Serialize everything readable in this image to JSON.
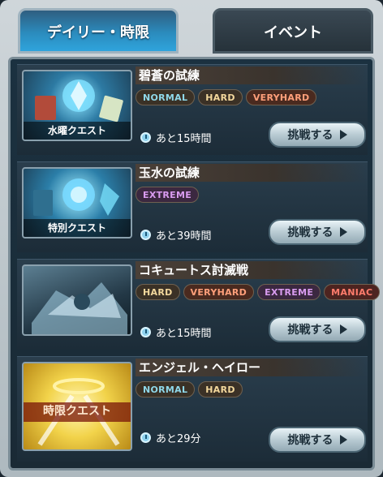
{
  "tabs": {
    "active_label": "デイリー・時限",
    "inactive_label": "イベント"
  },
  "quests": [
    {
      "banner_label": "水曜クエスト",
      "title": "碧蒼の試練",
      "difficulties": [
        "NORMAL",
        "HARD",
        "VERYHARD"
      ],
      "time": "あと15時間",
      "button": "挑戦する"
    },
    {
      "banner_label": "特別クエスト",
      "title": "玉水の試練",
      "difficulties": [
        "EXTREME"
      ],
      "time": "あと39時間",
      "button": "挑戦する"
    },
    {
      "banner_label": "",
      "title": "コキュートス討滅戦",
      "difficulties": [
        "HARD",
        "VERYHARD",
        "EXTREME",
        "MANIAC"
      ],
      "time": "あと15時間",
      "button": "挑戦する"
    },
    {
      "banner_label": "時限クエスト",
      "title": "エンジェル・ヘイロー",
      "difficulties": [
        "NORMAL",
        "HARD"
      ],
      "time": "あと29分",
      "button": "挑戦する"
    }
  ]
}
